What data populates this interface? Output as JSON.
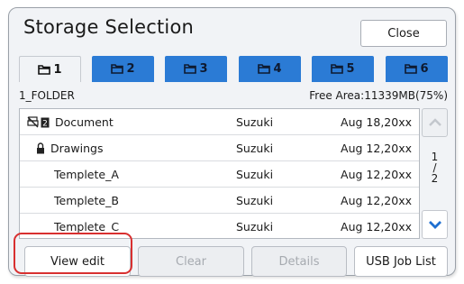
{
  "dialog": {
    "title": "Storage Selection",
    "close_label": "Close"
  },
  "tabs": [
    {
      "label": "1",
      "active": true
    },
    {
      "label": "2",
      "active": false
    },
    {
      "label": "3",
      "active": false
    },
    {
      "label": "4",
      "active": false
    },
    {
      "label": "5",
      "active": false
    },
    {
      "label": "6",
      "active": false
    }
  ],
  "folder": {
    "name": "1_FOLDER",
    "free_area": "Free Area:11339MB(75%)"
  },
  "columns_hidden": true,
  "files": [
    {
      "name": "Document",
      "owner": "Suzuki",
      "date": "Aug 18,20xx",
      "icon": "no-print-lock-icon"
    },
    {
      "name": "Drawings",
      "owner": "Suzuki",
      "date": "Aug 12,20xx",
      "icon": "lock-icon"
    },
    {
      "name": "Templete_A",
      "owner": "Suzuki",
      "date": "Aug 12,20xx"
    },
    {
      "name": "Templete_B",
      "owner": "Suzuki",
      "date": "Aug 12,20xx"
    },
    {
      "name": "Templete_C",
      "owner": "Suzuki",
      "date": "Aug 12,20xx"
    }
  ],
  "pager": {
    "current": "1",
    "separator": "/",
    "total": "2"
  },
  "buttons": {
    "view_edit": "View edit",
    "clear": "Clear",
    "details": "Details",
    "usb_job_list": "USB Job List"
  },
  "colors": {
    "tab_blue": "#2b7bd5",
    "highlight_red": "#d83030",
    "scroll_arrow": "#1f6fd0"
  }
}
